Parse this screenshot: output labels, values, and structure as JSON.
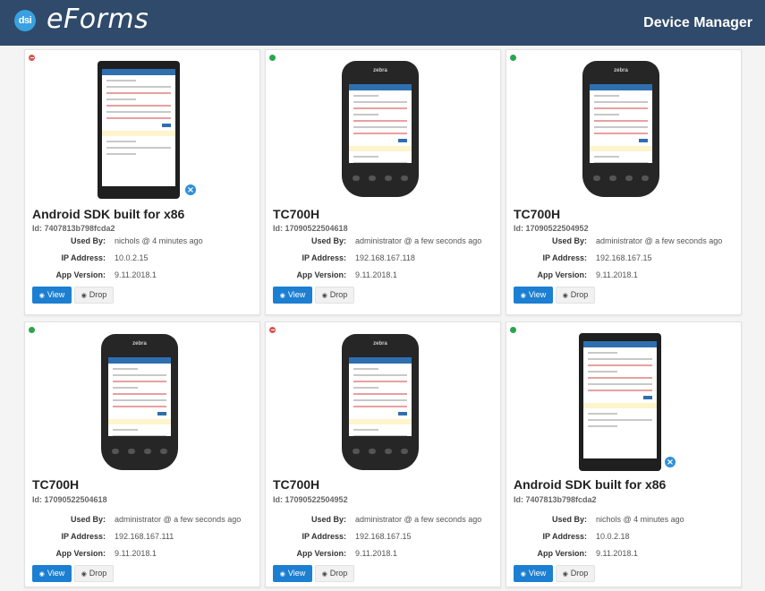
{
  "header": {
    "logo_badge": "dsi",
    "logo_text": "eForms",
    "title": "Device Manager"
  },
  "labels": {
    "used_by": "Used By:",
    "ip_address": "IP Address:",
    "app_version": "App Version:",
    "view": "View",
    "drop": "Drop",
    "remove_icon": "×"
  },
  "devices": [
    {
      "name": "Android SDK built for x86",
      "id": "Id: 7407813b798fcda2",
      "used_by": "nichols @ 4 minutes ago",
      "ip": "10.0.2.15",
      "app_version": "9.11.2018.1",
      "status": "offline",
      "device_type": "tablet"
    },
    {
      "name": "TC700H",
      "id": "Id: 17090522504618",
      "used_by": "administrator @ a few seconds ago",
      "ip": "192.168.167.118",
      "app_version": "9.11.2018.1",
      "status": "online",
      "device_type": "rugged"
    },
    {
      "name": "TC700H",
      "id": "Id: 17090522504952",
      "used_by": "administrator @ a few seconds ago",
      "ip": "192.168.167.15",
      "app_version": "9.11.2018.1",
      "status": "online",
      "device_type": "rugged"
    },
    {
      "name": "TC700H",
      "id": "Id: 17090522504618",
      "used_by": "administrator @ a few seconds ago",
      "ip": "192.168.167.111",
      "app_version": "9.11.2018.1",
      "status": "online",
      "device_type": "rugged"
    },
    {
      "name": "TC700H",
      "id": "Id: 17090522504952",
      "used_by": "administrator @ a few seconds ago",
      "ip": "192.168.167.15",
      "app_version": "9.11.2018.1",
      "status": "offline",
      "device_type": "rugged"
    },
    {
      "name": "Android SDK built for x86",
      "id": "Id: 7407813b798fcda2",
      "used_by": "nichols @ 4 minutes ago",
      "ip": "10.0.2.18",
      "app_version": "9.11.2018.1",
      "status": "online",
      "device_type": "tablet"
    }
  ],
  "colors": {
    "header_bg": "#2f4a6a",
    "view_button": "#1c7fd1",
    "online": "#2aa54b",
    "offline": "#d9534f"
  }
}
